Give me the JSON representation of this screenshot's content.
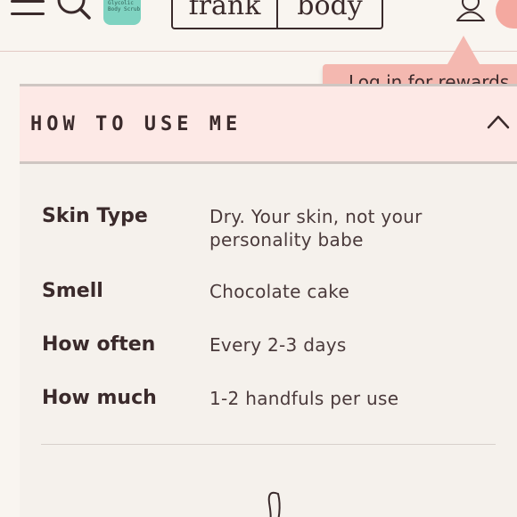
{
  "header": {
    "menu_icon": "hamburger-menu-icon",
    "search_icon": "search-icon",
    "product_label": "Glycolic Body Scrub",
    "logo_left": "frank",
    "logo_right": "body",
    "account_icon": "user-icon",
    "cart_icon": "cart-icon"
  },
  "tooltip": {
    "text": "Log in for rewards"
  },
  "accordion": {
    "title": "HOW TO USE ME",
    "toggle_icon": "chevron-up-icon",
    "rows": [
      {
        "label": "Skin Type",
        "value": "Dry. Your skin, not your personality babe"
      },
      {
        "label": "Smell",
        "value": "Chocolate cake"
      },
      {
        "label": "How often",
        "value": "Every 2-3 days"
      },
      {
        "label": "How much",
        "value": "1-2 handfuls per use"
      }
    ]
  },
  "colors": {
    "background": "#f9f5f0",
    "accent_pink": "#f4b8b0",
    "accordion_header": "#fde9e6",
    "product_mint": "#7fd3c1",
    "text": "#3a2a2b"
  }
}
